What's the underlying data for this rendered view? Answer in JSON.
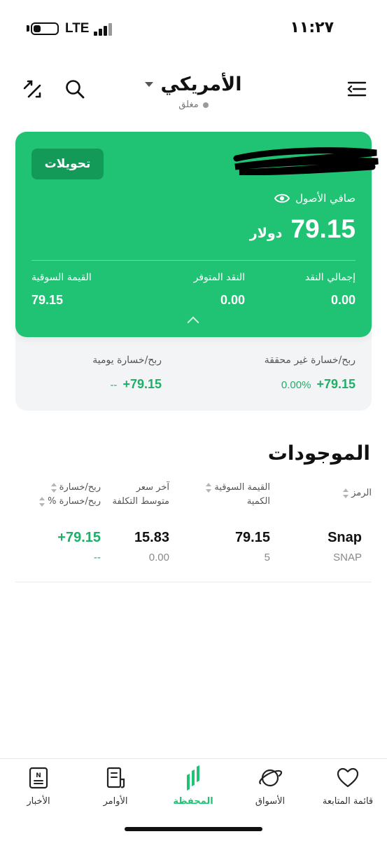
{
  "status_bar": {
    "time": "١١:٢٧",
    "network": "LTE"
  },
  "header": {
    "title": "الأمريكي",
    "market_status": "مغلق",
    "icons": [
      "trade-switch-icon",
      "search-icon",
      "menu-icon"
    ]
  },
  "account_card": {
    "transfers_label": "تحويلات",
    "net_assets_label": "صافي الأصول",
    "net_assets_value": "79.15",
    "currency": "دولار",
    "total_cash_label": "إجمالي النقد",
    "total_cash_value": "0.00",
    "available_cash_label": "النقد المتوفر",
    "available_cash_value": "0.00",
    "market_value_label": "القيمة السوقية",
    "market_value_value": "79.15",
    "colors": {
      "card": "#20c374",
      "button": "#149a58"
    }
  },
  "pl": {
    "unrealized_label": "ربح/خسارة غير محققة",
    "unrealized_value": "+79.15",
    "unrealized_pct": "0.00%",
    "daily_label": "ربح/خسارة يومية",
    "daily_value": "+79.15",
    "daily_pct": "--"
  },
  "holdings": {
    "title": "الموجودات",
    "columns": {
      "symbol": "الرمز",
      "market_value": "القيمة السوقية",
      "quantity": "الكمية",
      "last_price": "آخر سعر",
      "avg_cost": "متوسط التكلفة",
      "pl": "ربح/خسارة",
      "pl_pct": "ربح/خسارة %"
    },
    "rows": [
      {
        "name": "Snap",
        "symbol": "SNAP",
        "market_value": "79.15",
        "quantity": "5",
        "last_price": "15.83",
        "avg_cost": "0.00",
        "pl": "+79.15",
        "pl_pct": "--"
      }
    ]
  },
  "bottom_nav": {
    "items": [
      {
        "label": "قائمة المتابعة",
        "icon": "heart-icon",
        "active": false
      },
      {
        "label": "الأسواق",
        "icon": "planet-icon",
        "active": false
      },
      {
        "label": "المحفظة",
        "icon": "portfolio-icon",
        "active": true
      },
      {
        "label": "الأوامر",
        "icon": "orders-icon",
        "active": false
      },
      {
        "label": "الأخبار",
        "icon": "news-icon",
        "active": false
      }
    ]
  }
}
